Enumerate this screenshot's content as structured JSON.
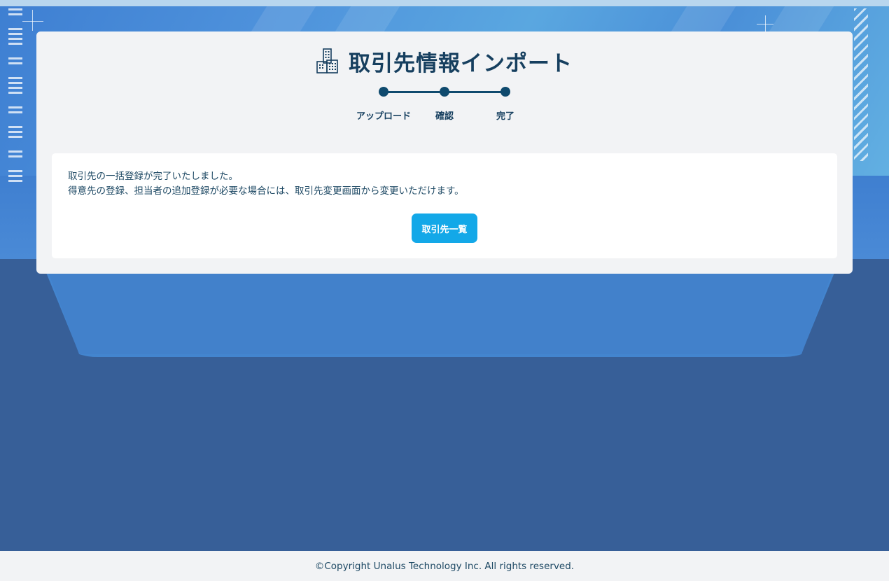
{
  "header": {
    "title": "取引先情報インポート",
    "title_icon": "building-icon"
  },
  "stepper": {
    "steps": [
      {
        "label": "アップロード"
      },
      {
        "label": "確認"
      },
      {
        "label": "完了"
      }
    ],
    "current_step": 3,
    "color": "#0f4a6e"
  },
  "main": {
    "message_line1": "取引先の一括登録が完了いたしました。",
    "message_line2": "得意先の登録、担当者の追加登録が必要な場合には、取引先変更画面から変更いただけます。",
    "button_label": "取引先一覧",
    "button_color": "#13a8e8"
  },
  "footer": {
    "copyright": "©Copyright Unalus Technology Inc. All rights reserved."
  }
}
